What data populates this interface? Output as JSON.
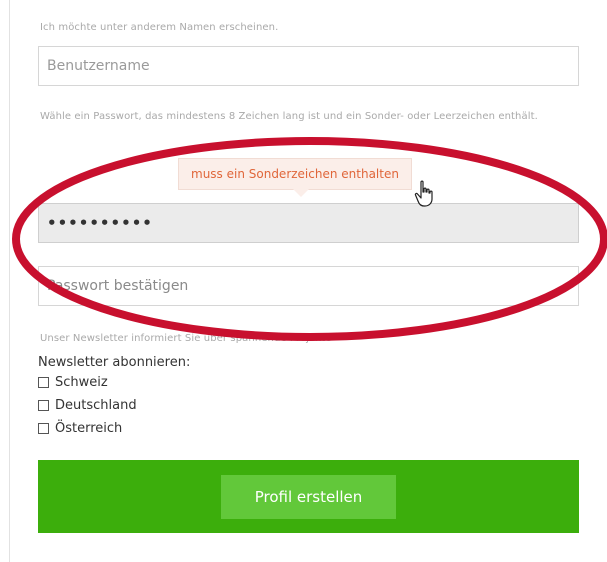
{
  "form": {
    "username_hint": "Ich möchte unter anderem Namen erscheinen.",
    "username_placeholder": "Benutzername",
    "password_hint": "Wähle ein Passwort, das mindestens 8 Zeichen lang ist und ein Sonder- oder Leerzeichen enthält.",
    "password_value": "••••••••••",
    "password_error": "muss ein Sonderzeichen enthalten",
    "confirm_placeholder": "Passwort bestätigen",
    "newsletter_hint": "Unser Newsletter informiert Sie über spannende Projekte",
    "newsletter_title": "Newsletter abonnieren:",
    "newsletter_options": [
      {
        "label": "Schweiz",
        "checked": false
      },
      {
        "label": "Deutschland",
        "checked": false
      },
      {
        "label": "Österreich",
        "checked": false
      }
    ],
    "submit_label": "Profil erstellen"
  },
  "colors": {
    "error_text": "#e0663a",
    "error_bg": "#fbeee9",
    "submit_bar": "#3cae0c",
    "submit_button": "#62c83a",
    "annotation": "#c8102e"
  },
  "icons": {
    "cursor": "hand-pointer-icon"
  }
}
